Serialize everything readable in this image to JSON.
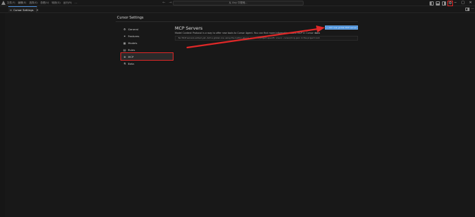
{
  "titlebar": {
    "menu": [
      "文件(F)",
      "编辑(E)",
      "选择(S)",
      "查看(V)",
      "转到(G)",
      "运行(R)",
      "..."
    ],
    "search_text": "从 Any 中搜索..."
  },
  "tab": {
    "label": "Cursor Settings"
  },
  "settings": {
    "title": "Cursor Settings",
    "nav": [
      {
        "label": "General",
        "icon": "gear-icon"
      },
      {
        "label": "Features",
        "icon": "sparkle-icon"
      },
      {
        "label": "Models",
        "icon": "cube-icon"
      },
      {
        "label": "Rules",
        "icon": "document-icon"
      },
      {
        "label": "MCP",
        "icon": "plug-icon"
      },
      {
        "label": "Beta",
        "icon": "flask-icon"
      }
    ],
    "active_nav": "MCP"
  },
  "mcp": {
    "title": "MCP Servers",
    "description": "Model Context Protocol is a way to offer new tools to Cursor Agent. You can find more information about MCP in Cursor",
    "docs_link": "docs",
    "empty_state": "No MCP servers added yet. Add a global one using the button above, or add a project-specific one in .cursor/mcp.json in the project root.",
    "add_button": "+ Add new global MCP server"
  },
  "colors": {
    "accent": "#4a90d9",
    "annotation": "#e02828",
    "background": "#181818"
  }
}
